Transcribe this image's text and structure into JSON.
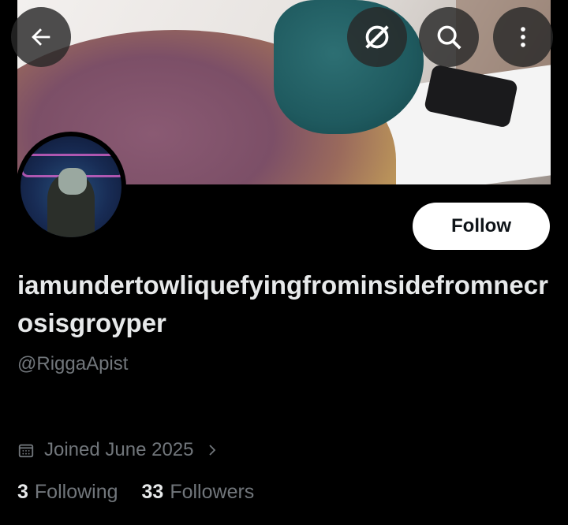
{
  "header": {
    "back_icon": "arrow-left-icon",
    "grok_icon": "grok-icon",
    "search_icon": "search-icon",
    "more_icon": "more-vertical-icon"
  },
  "profile": {
    "follow_label": "Follow",
    "display_name": "iamundertowliquefyingfrominsidefromnecrosisgroyper",
    "handle": "@RiggaApist",
    "joined": "Joined June 2025",
    "following_count": "3",
    "following_label": "Following",
    "followers_count": "33",
    "followers_label": "Followers"
  }
}
